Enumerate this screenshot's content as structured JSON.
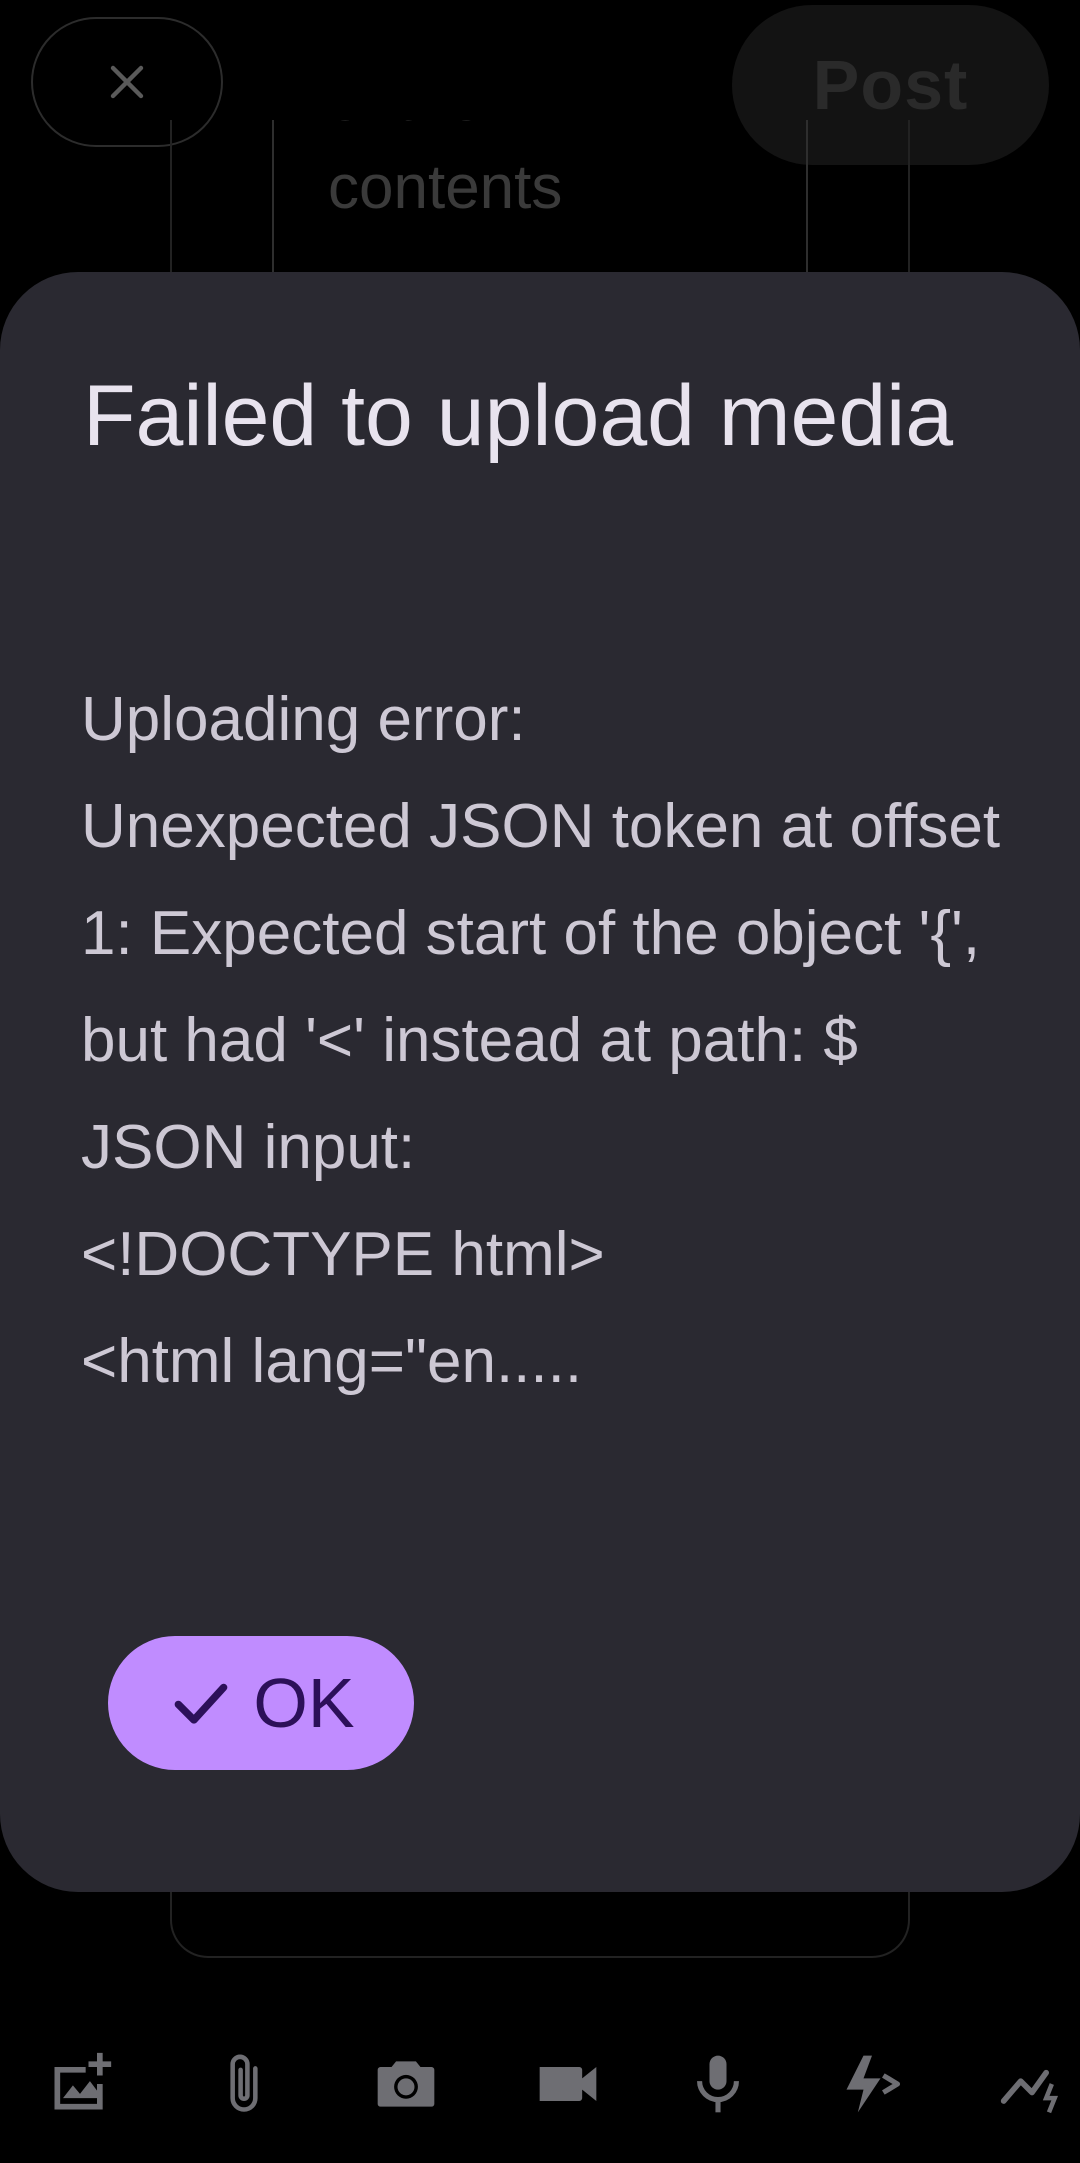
{
  "header": {
    "close_icon": "close-icon",
    "post_label": "Post"
  },
  "composer": {
    "content_preview": "of the\ncontents"
  },
  "dialog": {
    "title": "Failed to upload media",
    "message": "Uploading error:\nUnexpected JSON token at offset 1: Expected start of the object '{', but had '<' instead at path: $\nJSON input:\n<!DOCTYPE html>\n<html lang=\"en.....",
    "ok_label": "OK",
    "ok_icon": "check-icon"
  },
  "toolbar": {
    "items": [
      {
        "icon": "add-image-icon"
      },
      {
        "icon": "attachment-icon"
      },
      {
        "icon": "camera-icon"
      },
      {
        "icon": "video-icon"
      },
      {
        "icon": "microphone-icon"
      },
      {
        "icon": "quick-action-icon"
      },
      {
        "icon": "trend-icon"
      }
    ]
  },
  "colors": {
    "background": "#000000",
    "dialog_surface": "#2a2931",
    "accent": "#c08cff",
    "on_accent": "#2c1059",
    "title_text": "#e8e3ee",
    "body_text": "#cdc8d4",
    "toolbar_icon": "#6e6e73"
  }
}
